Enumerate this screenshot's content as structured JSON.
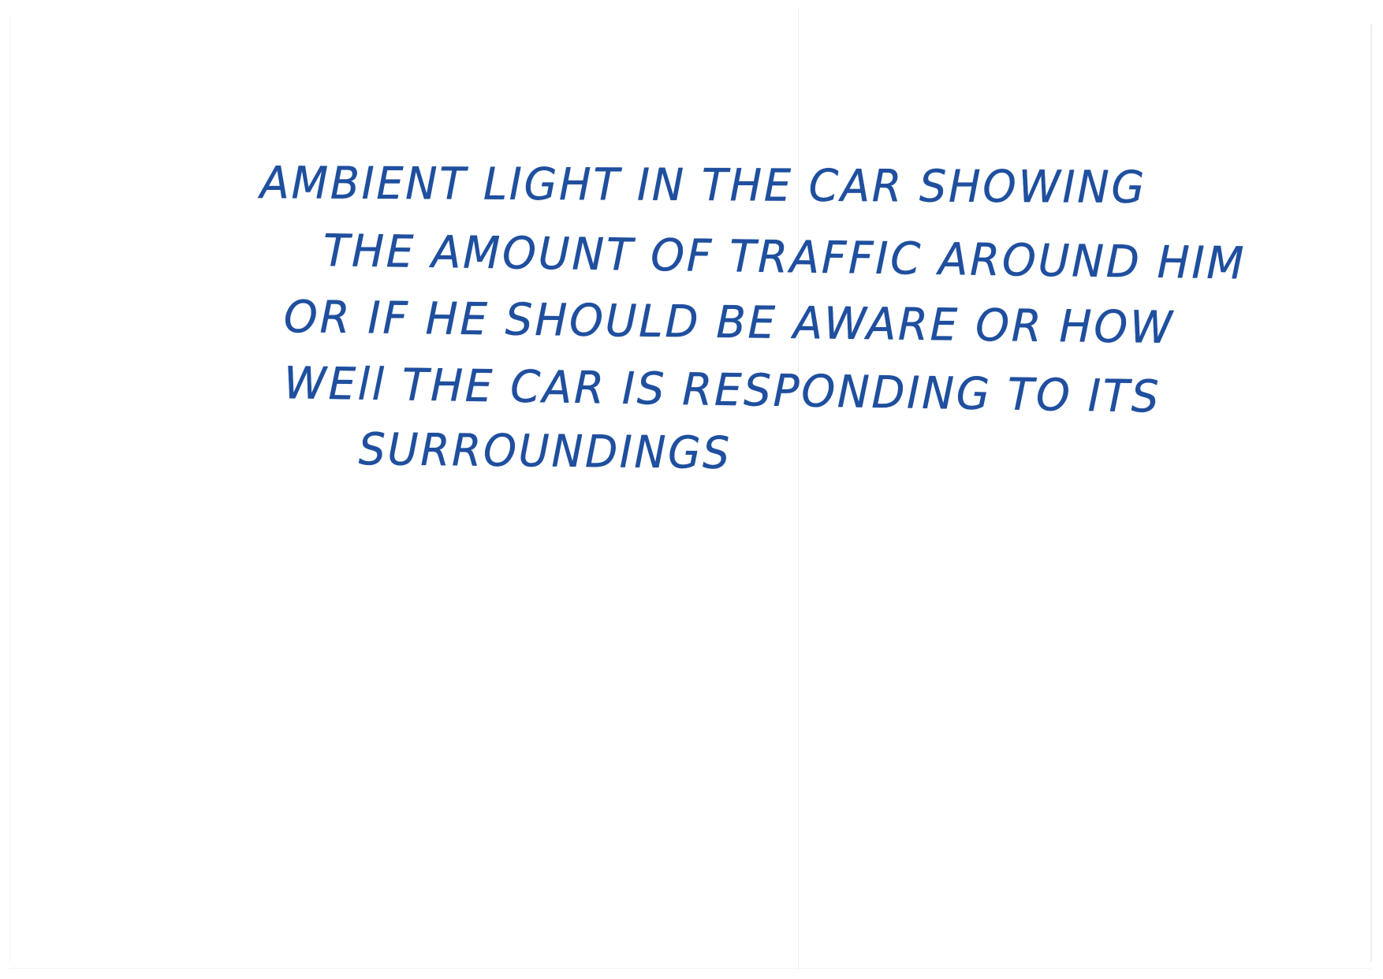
{
  "note": {
    "lines": [
      "AMBIENT LIGHT IN THE CAR SHOWING",
      "THE AMOUNT OF TRAFFIC AROUND HIM",
      "OR IF HE SHOULD BE AWARE OR HOW",
      "WEll THE CAR IS RESPONDING TO ITS",
      "SURROUNDINGS"
    ]
  },
  "colors": {
    "ink": "#1f4f9e",
    "paper": "#ffffff"
  }
}
